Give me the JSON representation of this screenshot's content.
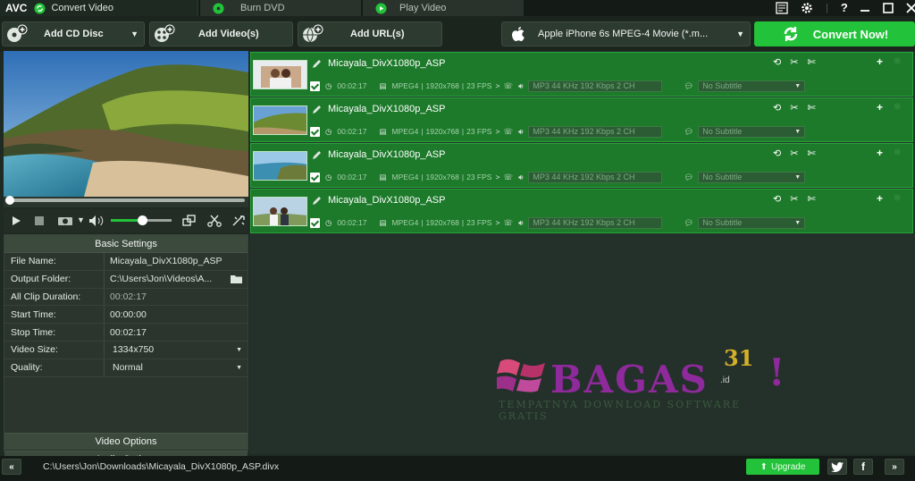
{
  "app": {
    "logo": "AVC"
  },
  "tabs": [
    {
      "label": "Convert Video"
    },
    {
      "label": "Burn DVD"
    },
    {
      "label": "Play Video"
    }
  ],
  "toolbar": {
    "add_cd": "Add CD Disc",
    "add_video": "Add Video(s)",
    "add_url": "Add URL(s)",
    "profile": "Apple iPhone 6s MPEG-4 Movie (*.m...",
    "convert": "Convert Now!"
  },
  "settings": {
    "header": "Basic Settings",
    "rows": [
      {
        "k": "File Name:",
        "v": "Micayala_DivX1080p_ASP"
      },
      {
        "k": "Output Folder:",
        "v": "C:\\Users\\Jon\\Videos\\A..."
      },
      {
        "k": "All Clip Duration:",
        "v": "00:02:17"
      },
      {
        "k": "Start Time:",
        "v": "00:00:00"
      },
      {
        "k": "Stop Time:",
        "v": "00:02:17"
      },
      {
        "k": "Video Size:",
        "v": "1334x750"
      },
      {
        "k": "Quality:",
        "v": "Normal"
      }
    ],
    "video_options": "Video Options",
    "audio_options": "Audio Options"
  },
  "files": [
    {
      "name": "Micayala_DivX1080p_ASP",
      "duration": "00:02:17",
      "codec": "MPEG4",
      "resolution": "1920x768",
      "fps": "23 FPS",
      "audio": "MP3 44 KHz 192 Kbps 2 CH",
      "subtitle": "No Subtitle"
    },
    {
      "name": "Micayala_DivX1080p_ASP",
      "duration": "00:02:17",
      "codec": "MPEG4",
      "resolution": "1920x768",
      "fps": "23 FPS",
      "audio": "MP3 44 KHz 192 Kbps 2 CH",
      "subtitle": "No Subtitle"
    },
    {
      "name": "Micayala_DivX1080p_ASP",
      "duration": "00:02:17",
      "codec": "MPEG4",
      "resolution": "1920x768",
      "fps": "23 FPS",
      "audio": "MP3 44 KHz 192 Kbps 2 CH",
      "subtitle": "No Subtitle"
    },
    {
      "name": "Micayala_DivX1080p_ASP",
      "duration": "00:02:17",
      "codec": "MPEG4",
      "resolution": "1920x768",
      "fps": "23 FPS",
      "audio": "MP3 44 KHz 192 Kbps 2 CH",
      "subtitle": "No Subtitle"
    }
  ],
  "watermark": {
    "brand": "BAGAS",
    "num": "31",
    "suffix": ".id",
    "tagline": "TEMPATNYA DOWNLOAD SOFTWARE GRATIS"
  },
  "status": {
    "path": "C:\\Users\\Jon\\Downloads\\Micayala_DivX1080p_ASP.divx",
    "upgrade": "Upgrade"
  },
  "colors": {
    "accent": "#22c33a",
    "item_bg": "#1c7a2a",
    "panel": "#2b352d"
  }
}
